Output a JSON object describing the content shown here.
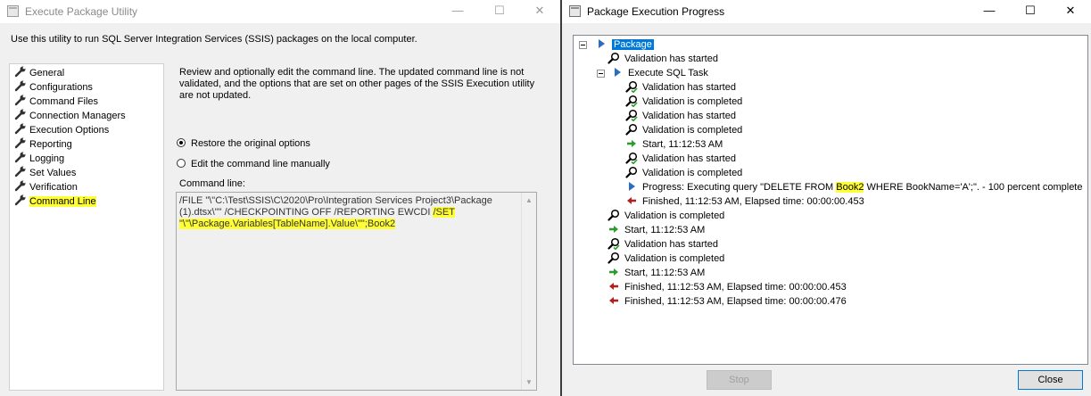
{
  "left_window": {
    "title": "Execute Package Utility",
    "intro": "Use this utility to run SQL Server Integration Services (SSIS) packages on the local computer.",
    "nav_items": [
      {
        "label": "General",
        "icon": "wrench-icon",
        "selected": false
      },
      {
        "label": "Configurations",
        "icon": "wrench-icon",
        "selected": false
      },
      {
        "label": "Command Files",
        "icon": "wrench-icon",
        "selected": false
      },
      {
        "label": "Connection Managers",
        "icon": "wrench-icon",
        "selected": false
      },
      {
        "label": "Execution Options",
        "icon": "wrench-icon",
        "selected": false
      },
      {
        "label": "Reporting",
        "icon": "wrench-icon",
        "selected": false
      },
      {
        "label": "Logging",
        "icon": "wrench-icon",
        "selected": false
      },
      {
        "label": "Set Values",
        "icon": "wrench-icon",
        "selected": false
      },
      {
        "label": "Verification",
        "icon": "wrench-icon",
        "selected": false
      },
      {
        "label": "Command Line",
        "icon": "wrench-icon",
        "selected": true
      }
    ],
    "description": "Review and optionally edit the command line. The updated command line is not validated, and the options that are set on other pages of the SSIS Execution utility are not updated.",
    "radio_restore": "Restore the original options",
    "radio_edit": "Edit the command line manually",
    "command_line_label": "Command line:",
    "command_line_plain": "/FILE \"\\\"C:\\Test\\SSIS\\C\\2020\\Pro\\Integration Services Project3\\Package (1).dtsx\\\"\" /CHECKPOINTING OFF  /REPORTING EWCDI ",
    "command_line_highlight": "/SET \"\\\"\\Package.Variables[TableName].Value\\\"\";Book2"
  },
  "right_window": {
    "title": "Package Execution Progress",
    "tree": [
      {
        "text": "Package",
        "icon": "play-icon",
        "level": 0,
        "expander": true,
        "selected": true
      },
      {
        "text": "Validation has started",
        "icon": "magnifier-icon",
        "level": 1
      },
      {
        "text": "Execute SQL Task",
        "icon": "play-icon",
        "level": 1,
        "expander": true
      },
      {
        "text": "Validation has started",
        "icon": "magnifier-check-icon",
        "level": 2
      },
      {
        "text": "Validation is completed",
        "icon": "magnifier-check-icon",
        "level": 2
      },
      {
        "text": "Validation has started",
        "icon": "magnifier-check-icon",
        "level": 2
      },
      {
        "text": "Validation is completed",
        "icon": "magnifier-icon",
        "level": 2
      },
      {
        "text": "Start, 11:12:53 AM",
        "icon": "green-arrow-icon",
        "level": 2
      },
      {
        "text": "Validation has started",
        "icon": "magnifier-check-icon",
        "level": 2
      },
      {
        "text": "Validation is completed",
        "icon": "magnifier-icon",
        "level": 2
      },
      {
        "text": "Progress: Executing query \"DELETE FROM ",
        "hl": "Book2",
        "after": " WHERE BookName='A';\". - 100 percent complete",
        "icon": "play-icon",
        "level": 2
      },
      {
        "text": "Finished, 11:12:53 AM, Elapsed time: 00:00:00.453",
        "icon": "red-arrow-icon",
        "level": 2
      },
      {
        "text": "Validation is completed",
        "icon": "magnifier-icon",
        "level": 1
      },
      {
        "text": "Start, 11:12:53 AM",
        "icon": "green-arrow-icon",
        "level": 1
      },
      {
        "text": "Validation has started",
        "icon": "magnifier-check-icon",
        "level": 1
      },
      {
        "text": "Validation is completed",
        "icon": "magnifier-icon",
        "level": 1
      },
      {
        "text": "Start, 11:12:53 AM",
        "icon": "green-arrow-icon",
        "level": 1
      },
      {
        "text": "Finished, 11:12:53 AM, Elapsed time: 00:00:00.453",
        "icon": "red-arrow-icon",
        "level": 1
      },
      {
        "text": "Finished, 11:12:53 AM, Elapsed time: 00:00:00.476",
        "icon": "red-arrow-icon",
        "level": 1
      }
    ],
    "stop_label": "Stop",
    "close_label": "Close"
  },
  "colors": {
    "highlight": "#ffff33",
    "selection": "#0078d7"
  }
}
